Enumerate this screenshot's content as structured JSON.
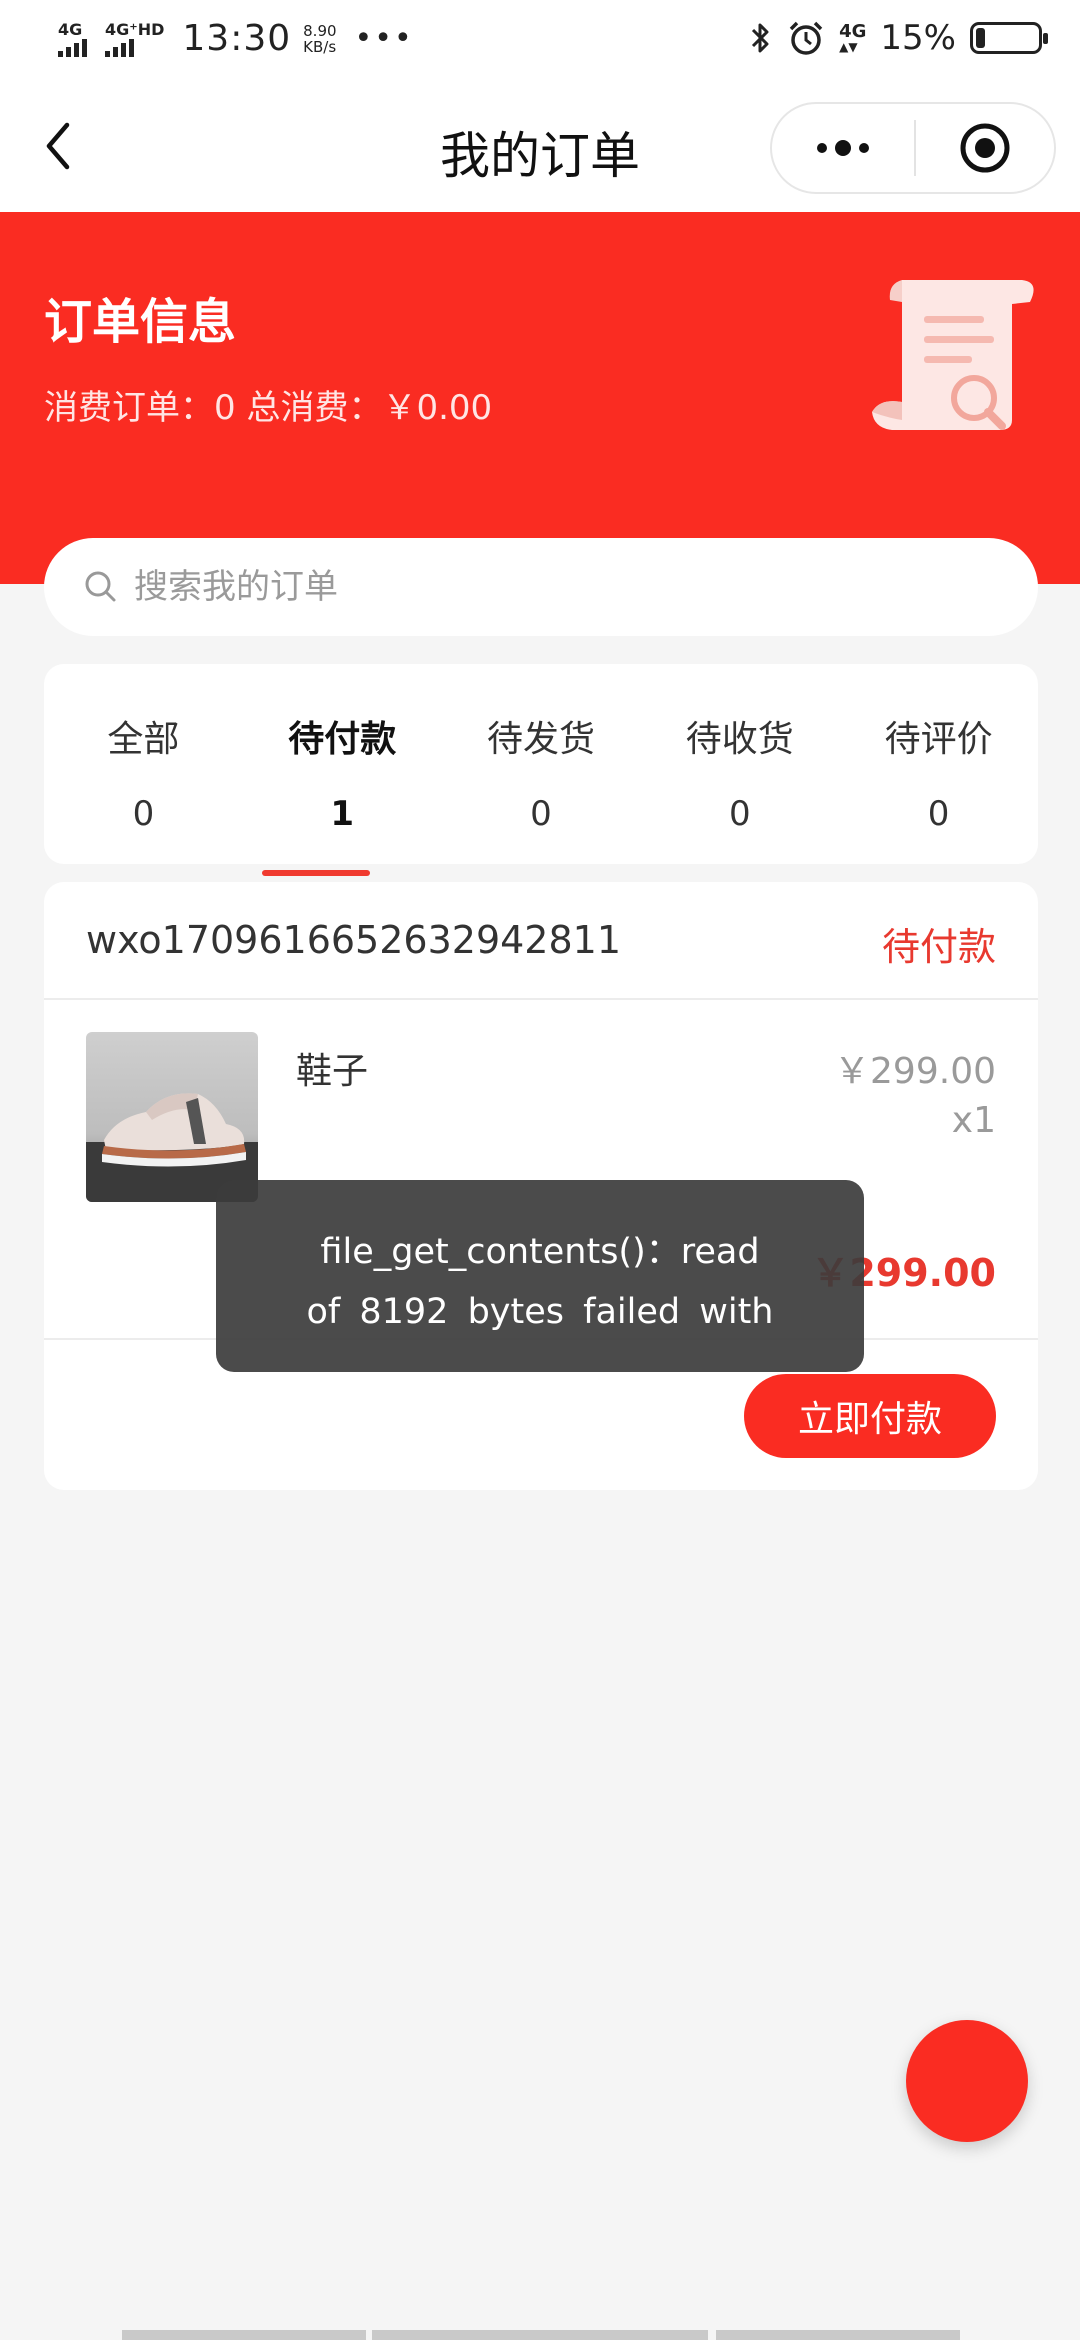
{
  "status_bar": {
    "network1": "4G",
    "network2": "4G⁺HD",
    "time": "13:30",
    "speed_value": "8.90",
    "speed_unit": "KB/s",
    "more": "•••",
    "network3": "4G",
    "battery": "15%",
    "battery_level": 0.15,
    "icons": [
      "bluetooth-icon",
      "alarm-icon",
      "battery-icon"
    ]
  },
  "navbar": {
    "title": "我的订单",
    "back_icon": "chevron-left-icon",
    "more_icon": "more-dots-icon",
    "close_icon": "target-icon"
  },
  "hero": {
    "title": "订单信息",
    "subtitle": "消费订单：0 总消费：￥0.00",
    "icon": "receipt-search-icon"
  },
  "search": {
    "placeholder": "搜索我的订单",
    "icon": "search-icon"
  },
  "tabs": [
    {
      "label": "全部",
      "count": "0"
    },
    {
      "label": "待付款",
      "count": "1",
      "active": true
    },
    {
      "label": "待发货",
      "count": "0"
    },
    {
      "label": "待收货",
      "count": "0"
    },
    {
      "label": "待评价",
      "count": "0"
    }
  ],
  "order": {
    "order_no": "wxo1709616652632942811",
    "status": "待付款",
    "item_name": "鞋子",
    "item_price": "￥299.00",
    "item_qty": "x1",
    "total": "￥299.00",
    "pay_button": "立即付款"
  },
  "toast": {
    "line1": "file_get_contents()：read",
    "line2": "of 8192 bytes failed with"
  },
  "colors": {
    "primary": "#fa2c22",
    "accent_text": "#e8392f",
    "background": "#f5f5f5"
  }
}
